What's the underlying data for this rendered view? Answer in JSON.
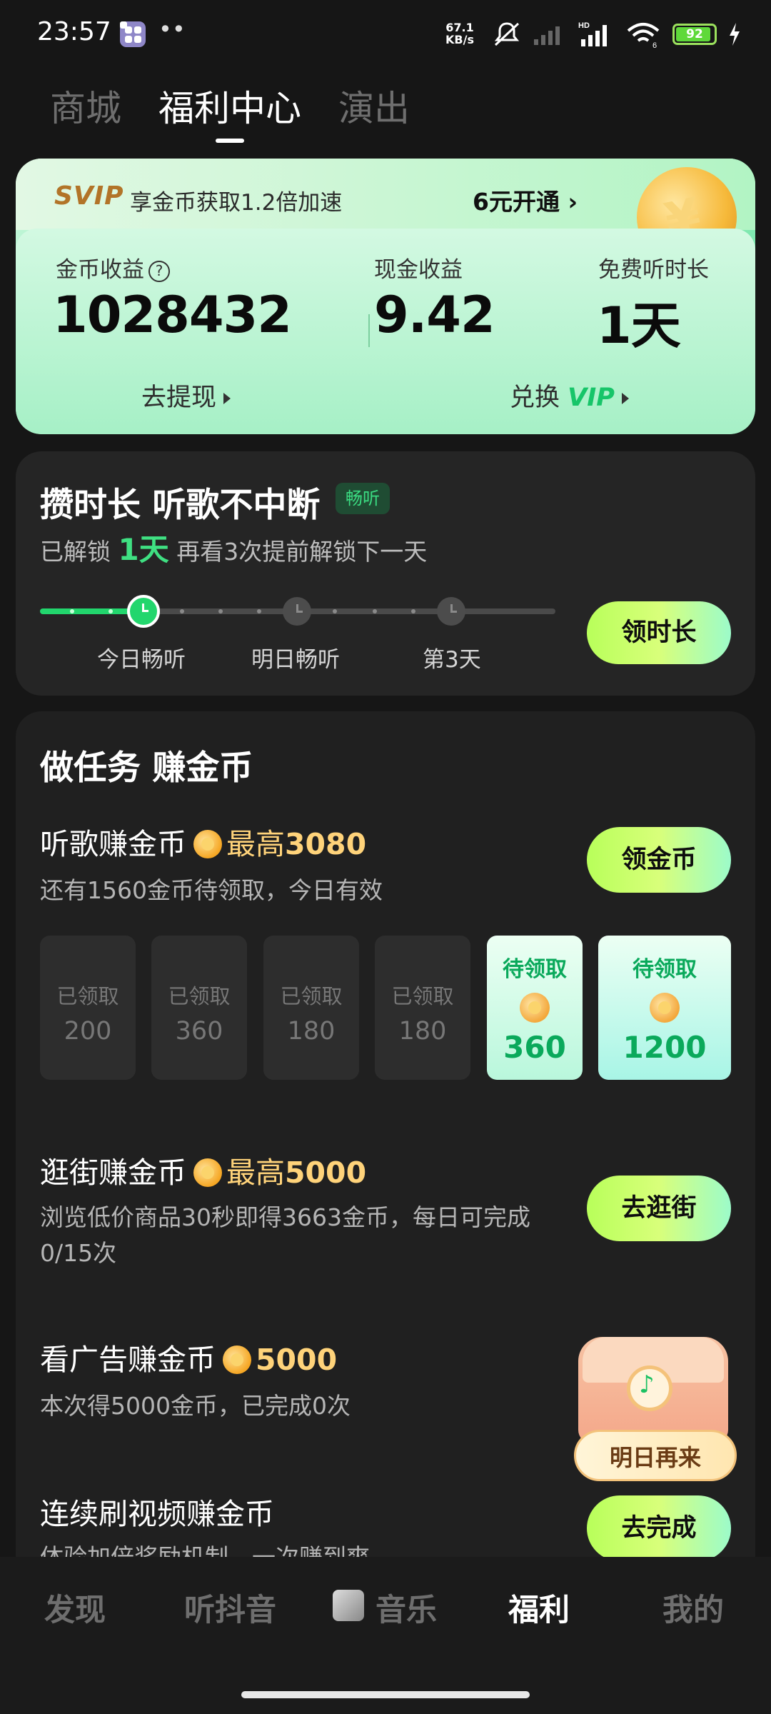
{
  "status_bar": {
    "time": "23:57",
    "more": "••",
    "net_speed": "67.1",
    "net_unit": "KB/s",
    "wifi_label": "6",
    "battery": "92",
    "battery_level": 0.92
  },
  "top_tabs": [
    {
      "label": "商城"
    },
    {
      "label": "福利中心"
    },
    {
      "label": "演出"
    }
  ],
  "svip": {
    "logo": "SVIP",
    "text": "享金币获取1.2倍加速",
    "cta": "6元开通 ›"
  },
  "earnings": {
    "coin_label": "金币收益",
    "help": "?",
    "coin_value": "1028432",
    "cash_label": "现金收益",
    "cash_value": "9.42",
    "free_label": "免费听时长",
    "free_value": "1天",
    "withdraw": "去提现",
    "exchange_prefix": "兑换",
    "exchange_vip": "VIP"
  },
  "duration": {
    "title": "攒时长 听歌不中断",
    "badge": "畅听",
    "sub_prefix": "已解锁",
    "sub_days": "1天",
    "sub_suffix": "再看3次提前解锁下一天",
    "labels": [
      "今日畅听",
      "明日畅听",
      "第3天"
    ],
    "button": "领时长"
  },
  "tasks": {
    "heading": "做任务 赚金币",
    "listen": {
      "title": "听歌赚金币",
      "max_prefix": "最高",
      "max_value": "3080",
      "sub": "还有1560金币待领取，今日有效",
      "button": "领金币",
      "tiles": [
        {
          "status": "已领取",
          "value": "200"
        },
        {
          "status": "已领取",
          "value": "360"
        },
        {
          "status": "已领取",
          "value": "180"
        },
        {
          "status": "已领取",
          "value": "180"
        },
        {
          "status": "待领取",
          "value": "360"
        },
        {
          "status": "待领取",
          "value": "1200"
        }
      ]
    },
    "shop": {
      "title": "逛街赚金币",
      "max_prefix": "最高",
      "max_value": "5000",
      "sub_line1": "浏览低价商品30秒即得3663金币，每日可完成",
      "sub_line2": "0/15次",
      "button": "去逛街"
    },
    "ad": {
      "title": "看广告赚金币",
      "value": "5000",
      "sub": "本次得5000金币，已完成0次",
      "chest_button": "明日再来"
    },
    "video": {
      "title": "连续刷视频赚金币",
      "sub": "体验加倍奖励机制，一次赚到爽",
      "button": "去完成"
    }
  },
  "bottom_nav": [
    {
      "label": "发现"
    },
    {
      "label": "听抖音"
    },
    {
      "label": "音乐"
    },
    {
      "label": "福利"
    },
    {
      "label": "我的"
    }
  ]
}
